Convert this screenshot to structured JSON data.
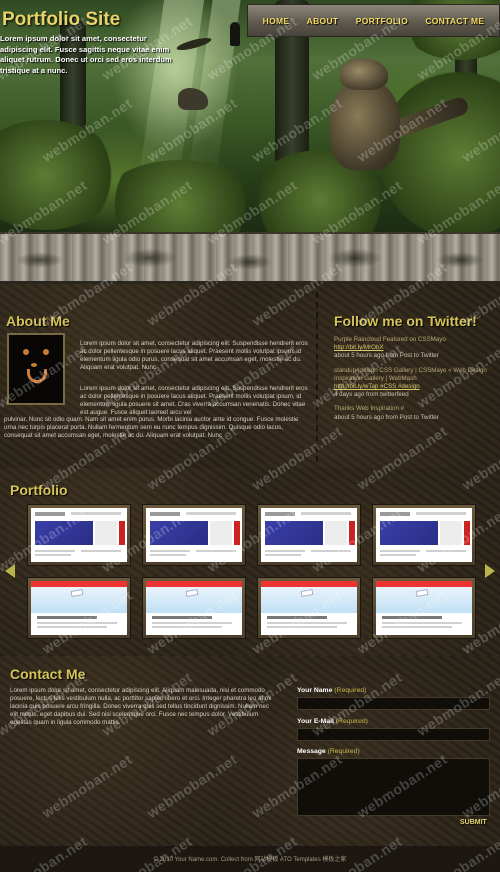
{
  "header": {
    "site_title": "Portfolio Site",
    "intro": "Lorem ipsum dolor sit amet, consectetur adipiscing elit. Fusce sagittis neque vitae enim aliquet rutrum. Donec ut orci sed eros interdum tristique at a nunc."
  },
  "nav": {
    "items": [
      "HOME",
      "ABOUT",
      "PORTFOLIO",
      "CONTACT ME"
    ]
  },
  "about": {
    "title": "About Me",
    "paragraph1": "Lorem ipsum dolor sit amet, consectetur adipiscing elit. Suspendisse hendrerit eros ac dolor pellentesque in posuere lacus aliquet. Praesent mollis volutpat ipsum, id elementum ligula odio purus, consequat sit amet accumsan eget, molestie ac du. Aliquam erat volutpat. Nunc",
    "paragraph2": "Lorem ipsum dolor sit amet, consectetur adipiscing elit. Suspendisse hendrerit eros ac dolor pellentesque in posuere lacus aliquet. Praesent mollis volutpat ipsum, id elementum ligula posuere sit amet. Cras viverra accumsan venenatis. Donec vitae est augue. Fusce aliquet laoreet arcu vel",
    "paragraph3": "pulvinar. Nunc sit odio quam. Nam sit amet enim purus. Morbi lacinia auctor ante id congue. Fusce molestie urna nec turpis placerat porta. Nullam fermentum sem eu nunc tempus dignissim. Quisque odio lacus, consequat sit amet accumsan eget, molestie ac du. Aliquam erat volutpat. Nunc"
  },
  "twitter": {
    "title": "Follow me on Twitter!",
    "tweets": [
      {
        "text": "Purple Raincloud Featured on CSSMayo",
        "link": "http://bit.ly/MrObX",
        "meta": "about 5 hours ago from Post to Twitter"
      },
      {
        "text": "standup4design CSS Gallery | CSSMayo « Web Design Inspiration Gallery | WebMash",
        "link": "http://bit.ly/wTap #CSS #design",
        "meta": "4 days ago from twitterfeed"
      },
      {
        "text": "Thanks Web Inspiration #",
        "link": "",
        "meta": "about 5 hours ago from Post to Twitter"
      }
    ]
  },
  "portfolio": {
    "title": "Portfolio",
    "thumbnails": [
      {
        "style": "t1"
      },
      {
        "style": "t1"
      },
      {
        "style": "t1"
      },
      {
        "style": "t1"
      },
      {
        "style": "t2"
      },
      {
        "style": "t2"
      },
      {
        "style": "t2"
      },
      {
        "style": "t2"
      }
    ]
  },
  "contact": {
    "title": "Contact Me",
    "text": "Lorem ipsum dolor sit amet, consectetur adipiscing elit. Aliquam malesuada, nisi et commodo posuere, lectus felis vestibulum nulla, ac porttitor sapien libero et orci. Integer pharetra leo at mi lacinia quis posuere arcu fringilla. Donec viverra quis sed tellus tincidunt dignissim. Nullam nec elit metus, eget dapibus dui. Sed nisi scelerisque orci. Fusce nec tempus dolor. Vestibulum egestas quam in ligula commodo mattis.",
    "name_label": "Your Name",
    "email_label": "Your E-Mail",
    "message_label": "Message",
    "required": "(Required)",
    "submit": "SUBMIT"
  },
  "footer": {
    "text": "© 2010 Your Name.com. Collect from 网站模板 ATO Templates 模板之家"
  },
  "watermark": {
    "text": "webmoban.net"
  },
  "colors": {
    "accent": "#d6c45a",
    "nav_text": "#f4da63",
    "background": "#2b241a"
  }
}
